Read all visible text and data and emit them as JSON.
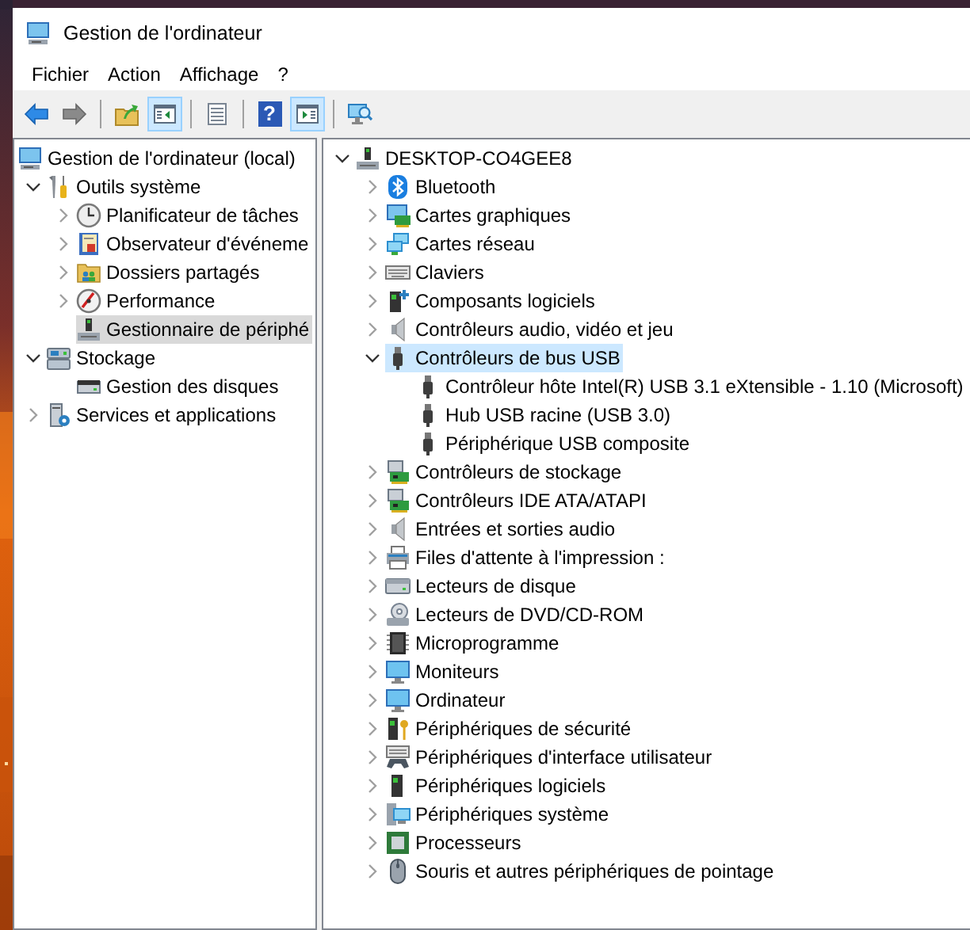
{
  "wallpaper": {
    "kind": "picture"
  },
  "window": {
    "title": "Gestion de l'ordinateur"
  },
  "menu": [
    "Fichier",
    "Action",
    "Affichage",
    "?"
  ],
  "toolbar": [
    {
      "kind": "back",
      "disabled": false
    },
    {
      "kind": "forward",
      "disabled": true
    },
    {
      "kind": "separator"
    },
    {
      "kind": "up",
      "disabled": false
    },
    {
      "kind": "tree",
      "pressed": true
    },
    {
      "kind": "separator"
    },
    {
      "kind": "export",
      "disabled": false
    },
    {
      "kind": "separator"
    },
    {
      "kind": "help",
      "glyph": "?"
    },
    {
      "kind": "actionpane",
      "pressed": true
    },
    {
      "kind": "separator"
    },
    {
      "kind": "scan",
      "disabled": false
    }
  ],
  "console_tree": [
    {
      "label": "Gestion de l'ordinateur (local)",
      "kind": "computer",
      "selected": false,
      "children": [
        {
          "label": "Outils système",
          "kind": "tools",
          "expanded": true,
          "selected": false,
          "children": [
            {
              "label": "Planificateur de tâches",
              "kind": "clock",
              "expanded": false,
              "selected": false
            },
            {
              "label": "Observateur d'événeme",
              "kind": "log",
              "expanded": false,
              "selected": false
            },
            {
              "label": "Dossiers partagés",
              "kind": "folder",
              "expanded": false,
              "selected": false
            },
            {
              "label": "Performance",
              "kind": "gauge",
              "expanded": false,
              "selected": false
            },
            {
              "label": "Gestionnaire de périphé",
              "kind": "device",
              "selected": true
            }
          ]
        },
        {
          "label": "Stockage",
          "kind": "storage",
          "expanded": true,
          "selected": false,
          "children": [
            {
              "label": "Gestion des disques",
              "kind": "disk",
              "selected": false
            }
          ]
        },
        {
          "label": "Services et applications",
          "kind": "services",
          "expanded": false,
          "selected": false
        }
      ]
    }
  ],
  "device_tree": [
    {
      "label": "DESKTOP-CO4GEE8",
      "kind": "device",
      "expanded": true,
      "selected": false,
      "children": [
        {
          "label": "Bluetooth",
          "kind": "bluetooth",
          "expanded": false,
          "selected": false
        },
        {
          "label": "Cartes graphiques",
          "kind": "graphics",
          "expanded": false,
          "selected": false
        },
        {
          "label": "Cartes réseau",
          "kind": "network",
          "expanded": false,
          "selected": false
        },
        {
          "label": "Claviers",
          "kind": "keyboard",
          "expanded": false,
          "selected": false
        },
        {
          "label": "Composants logiciels",
          "kind": "towerplus",
          "expanded": false,
          "selected": false
        },
        {
          "label": "Contrôleurs audio, vidéo et jeu",
          "kind": "speaker",
          "expanded": false,
          "selected": false
        },
        {
          "label": "Contrôleurs de bus USB",
          "kind": "usb",
          "expanded": true,
          "selected": true,
          "children": [
            {
              "label": "Contrôleur hôte Intel(R) USB 3.1 eXtensible - 1.10 (Microsoft)",
              "kind": "usb",
              "selected": false
            },
            {
              "label": "Hub USB racine (USB 3.0)",
              "kind": "usb",
              "selected": false
            },
            {
              "label": "Périphérique USB composite",
              "kind": "usb",
              "selected": false
            }
          ]
        },
        {
          "label": "Contrôleurs de stockage",
          "kind": "card",
          "expanded": false,
          "selected": false
        },
        {
          "label": "Contrôleurs IDE ATA/ATAPI",
          "kind": "card",
          "expanded": false,
          "selected": false
        },
        {
          "label": "Entrées et sorties audio",
          "kind": "speaker",
          "expanded": false,
          "selected": false
        },
        {
          "label": "Files d'attente à l'impression :",
          "kind": "printer",
          "expanded": false,
          "selected": false
        },
        {
          "label": "Lecteurs de disque",
          "kind": "drive",
          "expanded": false,
          "selected": false
        },
        {
          "label": "Lecteurs de DVD/CD-ROM",
          "kind": "dvd",
          "expanded": false,
          "selected": false
        },
        {
          "label": "Microprogramme",
          "kind": "chip",
          "expanded": false,
          "selected": false
        },
        {
          "label": "Moniteurs",
          "kind": "monitor",
          "expanded": false,
          "selected": false
        },
        {
          "label": "Ordinateur",
          "kind": "monitor",
          "expanded": false,
          "selected": false
        },
        {
          "label": "Périphériques de sécurité",
          "kind": "towerkey",
          "expanded": false,
          "selected": false
        },
        {
          "label": "Périphériques d'interface utilisateur",
          "kind": "hid",
          "expanded": false,
          "selected": false
        },
        {
          "label": "Périphériques logiciels",
          "kind": "tower",
          "expanded": false,
          "selected": false
        },
        {
          "label": "Périphériques système",
          "kind": "system",
          "expanded": false,
          "selected": false
        },
        {
          "label": "Processeurs",
          "kind": "cpu",
          "expanded": false,
          "selected": false
        },
        {
          "label": "Souris et autres périphériques de pointage",
          "kind": "mouse",
          "expanded": false,
          "selected": false
        }
      ]
    }
  ]
}
